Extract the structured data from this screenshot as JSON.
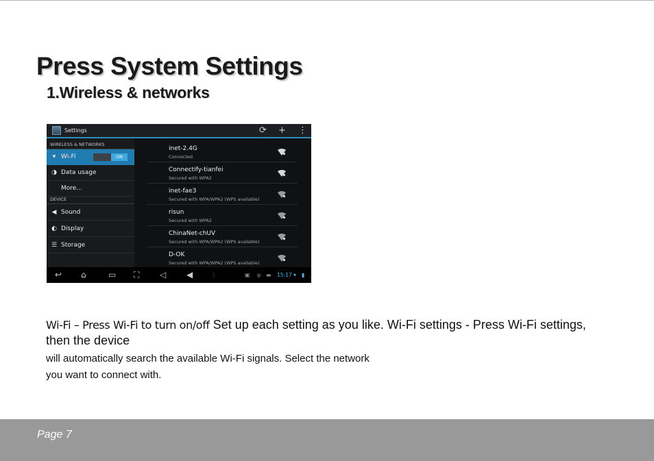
{
  "heading": "Press System Settings",
  "subheading": "1.Wireless & networks",
  "screenshot": {
    "title": "Settings",
    "actions": [
      {
        "name": "sync-icon",
        "glyph": "⟳"
      },
      {
        "name": "add-icon",
        "glyph": "+"
      },
      {
        "name": "overflow-menu-icon",
        "glyph": "⋮"
      }
    ],
    "sections": {
      "wireless": "WIRELESS & NETWORKS",
      "device": "DEVICE"
    },
    "wireless_items": [
      {
        "label": "Wi-Fi",
        "icon": "wifi-icon",
        "glyph": "▾"
      },
      {
        "label": "Data usage",
        "icon": "data-usage-icon",
        "glyph": "◑"
      },
      {
        "label": "More...",
        "icon": "",
        "glyph": ""
      }
    ],
    "wifi_toggle": "ON",
    "device_items": [
      {
        "label": "Sound",
        "icon": "speaker-icon",
        "glyph": "◀"
      },
      {
        "label": "Display",
        "icon": "display-icon",
        "glyph": "◐"
      },
      {
        "label": "Storage",
        "icon": "storage-icon",
        "glyph": "☰"
      }
    ],
    "networks": [
      {
        "name": "inet-2.4G",
        "status": "Connected"
      },
      {
        "name": "Connectify-tianfei",
        "status": "Secured with WPA2"
      },
      {
        "name": "inet-fae3",
        "status": "Secured with WPA/WPA2 (WPS available)"
      },
      {
        "name": "risun",
        "status": "Secured with WPA2"
      },
      {
        "name": "ChinaNet-chUV",
        "status": "Secured with WPA/WPA2 (WPS available)"
      },
      {
        "name": "D-OK",
        "status": "Secured with WPA/WPA2 (WPS available)"
      }
    ],
    "clock": "15:17"
  },
  "body": {
    "wifi_label": "Wi-Fi – Press Wi-Fi to turn on/off",
    "line1": "Set up each setting as you like. Wi-Fi settings - Press Wi-Fi settings, then the device",
    "line2": "will automatically search the available Wi-Fi signals. Select the network",
    "line3": "you want to connect with."
  },
  "footer": {
    "page": "Page 7"
  }
}
